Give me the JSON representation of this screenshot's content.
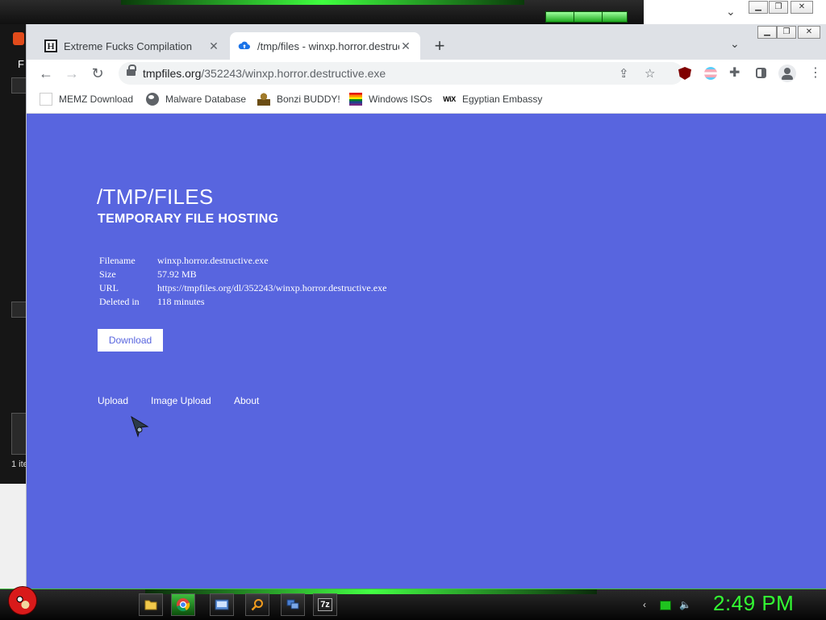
{
  "browser": {
    "tabs": [
      {
        "title": "Extreme Fucks Compilation",
        "favicon": "h-letter-icon",
        "active": false
      },
      {
        "title": "/tmp/files - winxp.horror.destructive.exe",
        "favicon": "cloud-upload-icon",
        "active": true
      }
    ],
    "new_tab_label": "+",
    "address": {
      "domain": "tmpfiles.org",
      "path": "/352243/winxp.horror.destructive.exe"
    },
    "bookmarks": [
      {
        "label": "MEMZ Download",
        "icon": "memz-icon"
      },
      {
        "label": "Malware Database",
        "icon": "globe-icon"
      },
      {
        "label": "Bonzi BUDDY!",
        "icon": "bonzi-icon"
      },
      {
        "label": "Windows ISOs",
        "icon": "rainbow-flag-icon"
      },
      {
        "label": "Egyptian Embassy",
        "icon": "wix-icon",
        "icon_text": "WiX"
      }
    ]
  },
  "page": {
    "title": "/TMP/FILES",
    "subtitle": "TEMPORARY FILE HOSTING",
    "file_info": [
      {
        "key": "Filename",
        "value": "winxp.horror.destructive.exe"
      },
      {
        "key": "Size",
        "value": "57.92 MB"
      },
      {
        "key": "URL",
        "value": "https://tmpfiles.org/dl/352243/winxp.horror.destructive.exe"
      },
      {
        "key": "Deleted in",
        "value": "118 minutes"
      }
    ],
    "download_label": "Download",
    "nav": [
      "Upload",
      "Image Upload",
      "About"
    ]
  },
  "background_window": {
    "letter": "F",
    "status_text": "1 ite"
  },
  "taskbar": {
    "clock": "2:49 PM",
    "archive_label": "7z"
  },
  "colors": {
    "page_bg": "#5865df",
    "taskbar_accent": "#33ff33"
  }
}
